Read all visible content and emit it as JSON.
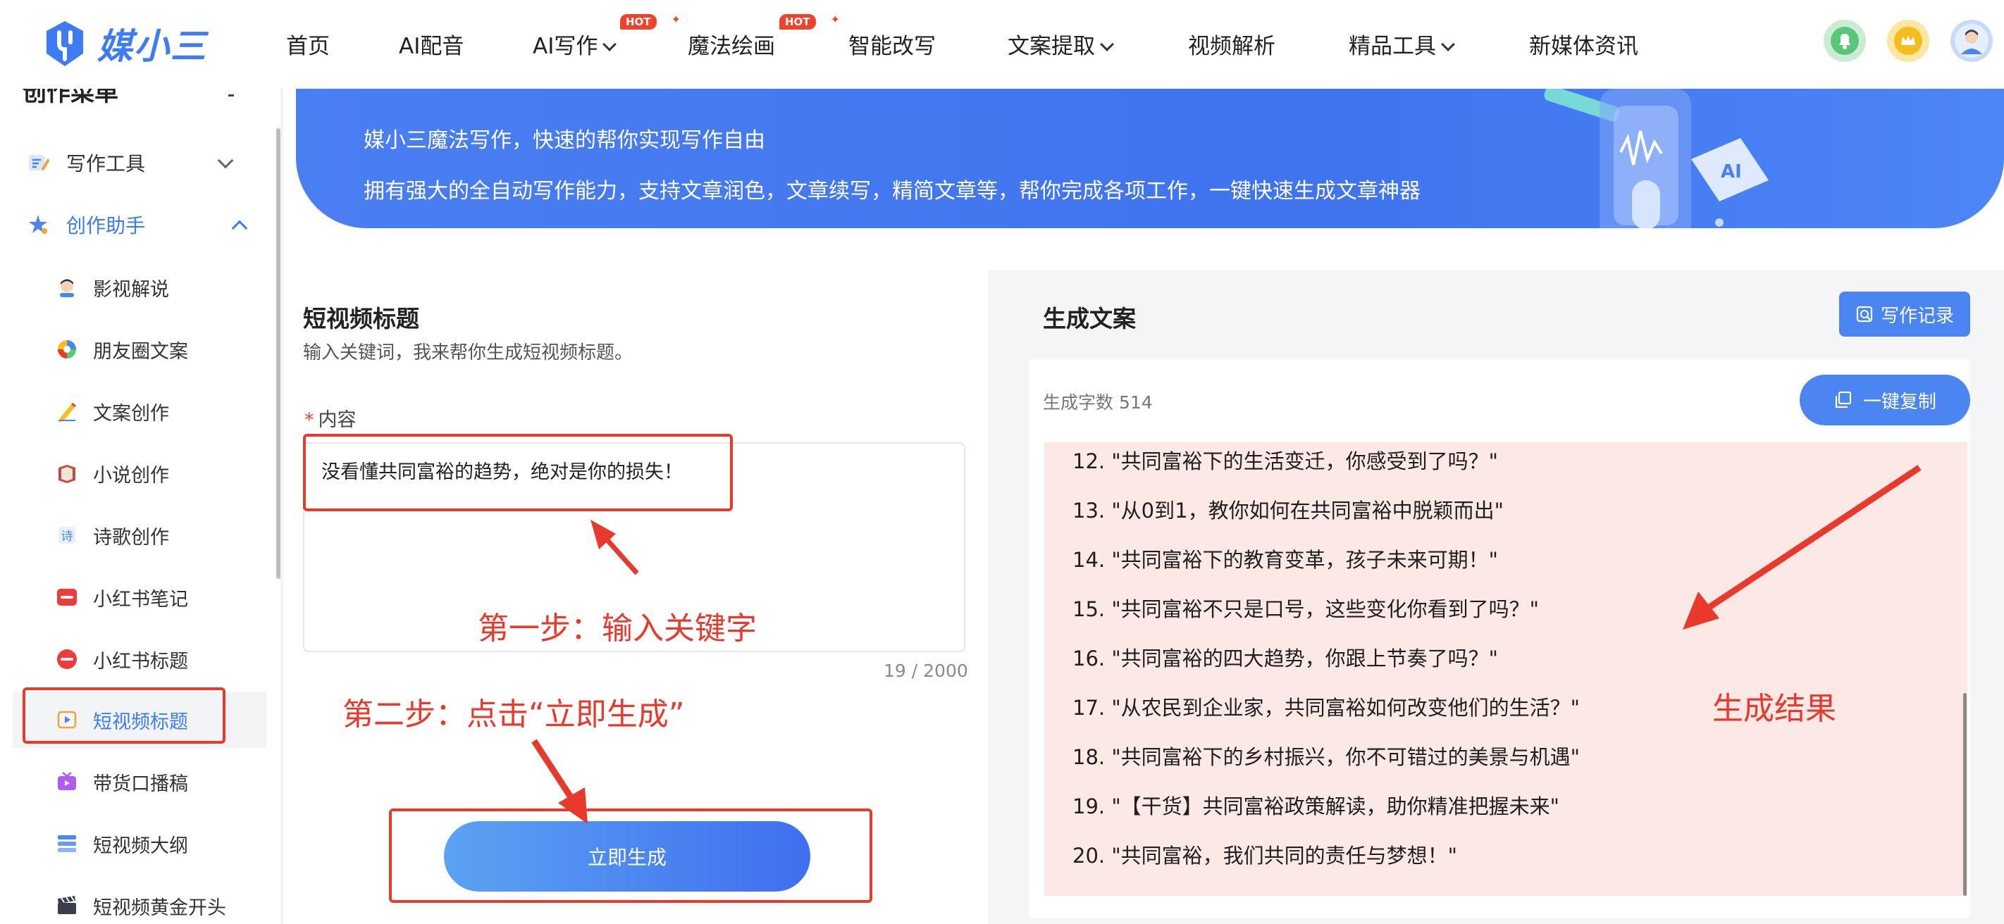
{
  "brand": {
    "name": "媒小三",
    "color": "#3d7cf5"
  },
  "nav": {
    "items": [
      {
        "label": "首页",
        "dropdown": false,
        "hot": false
      },
      {
        "label": "AI配音",
        "dropdown": false,
        "hot": false
      },
      {
        "label": "AI写作",
        "dropdown": true,
        "hot": true
      },
      {
        "label": "魔法绘画",
        "dropdown": false,
        "hot": true
      },
      {
        "label": "智能改写",
        "dropdown": false,
        "hot": false
      },
      {
        "label": "文案提取",
        "dropdown": true,
        "hot": false
      },
      {
        "label": "视频解析",
        "dropdown": false,
        "hot": false
      },
      {
        "label": "精品工具",
        "dropdown": true,
        "hot": false
      },
      {
        "label": "新媒体资讯",
        "dropdown": false,
        "hot": false
      }
    ],
    "hot_badge": "HOT",
    "icons": [
      "bell-icon",
      "crown-icon",
      "avatar"
    ]
  },
  "sidebar": {
    "cut_heading": "创作菜单",
    "sections": [
      {
        "label": "写作工具",
        "icon": "writing-tool-icon",
        "expanded": false
      },
      {
        "label": "创作助手",
        "icon": "creation-assistant-icon",
        "expanded": true
      }
    ],
    "items": [
      {
        "label": "影视解说",
        "icon": "film-narration-icon"
      },
      {
        "label": "朋友圈文案",
        "icon": "moments-icon"
      },
      {
        "label": "文案创作",
        "icon": "pencil-icon"
      },
      {
        "label": "小说创作",
        "icon": "book-icon"
      },
      {
        "label": "诗歌创作",
        "icon": "poem-icon"
      },
      {
        "label": "小红书笔记",
        "icon": "xiaohongshu-icon"
      },
      {
        "label": "小红书标题",
        "icon": "xiaohongshu-title-icon"
      },
      {
        "label": "短视频标题",
        "icon": "short-video-icon",
        "active": true
      },
      {
        "label": "带货口播稿",
        "icon": "tv-icon"
      },
      {
        "label": "短视频大纲",
        "icon": "outline-icon"
      },
      {
        "label": "短视频黄金开头",
        "icon": "clapper-icon"
      }
    ],
    "active_color": "#3d7cf5"
  },
  "banner": {
    "line1": "媒小三魔法写作，快速的帮你实现写作自由",
    "line2": "拥有强大的全自动写作能力，支持文章润色，文章续写，精简文章等，帮你完成各项工作，一键快速生成文章神器"
  },
  "form": {
    "title": "短视频标题",
    "subtitle": "输入关键词，我来帮你生成短视频标题。",
    "required_mark": "*",
    "content_label": "内容",
    "content_value": "没看懂共同富裕的趋势，绝对是你的损失！",
    "counter": "19 / 2000",
    "generate_label": "立即生成"
  },
  "result": {
    "title": "生成文案",
    "record_label": "写作记录",
    "word_count": "生成字数 514",
    "copy_label": "一键复制",
    "lines": [
      "12. \"共同富裕下的生活变迁，你感受到了吗？\"",
      "13. \"从0到1，教你如何在共同富裕中脱颖而出\"",
      "14. \"共同富裕下的教育变革，孩子未来可期！\"",
      "15. \"共同富裕不只是口号，这些变化你看到了吗？\"",
      "16. \"共同富裕的四大趋势，你跟上节奏了吗？\"",
      "17. \"从农民到企业家，共同富裕如何改变他们的生活？\"",
      "18. \"共同富裕下的乡村振兴，你不可错过的美景与机遇\"",
      "19. \"【干货】共同富裕政策解读，助你精准把握未来\"",
      "20. \"共同富裕，我们共同的责任与梦想！\""
    ]
  },
  "annotations": {
    "step1": "第一步：输入关键字",
    "step2": "第二步：点击“立即生成”",
    "result": "生成结果",
    "color": "#e8392c"
  }
}
